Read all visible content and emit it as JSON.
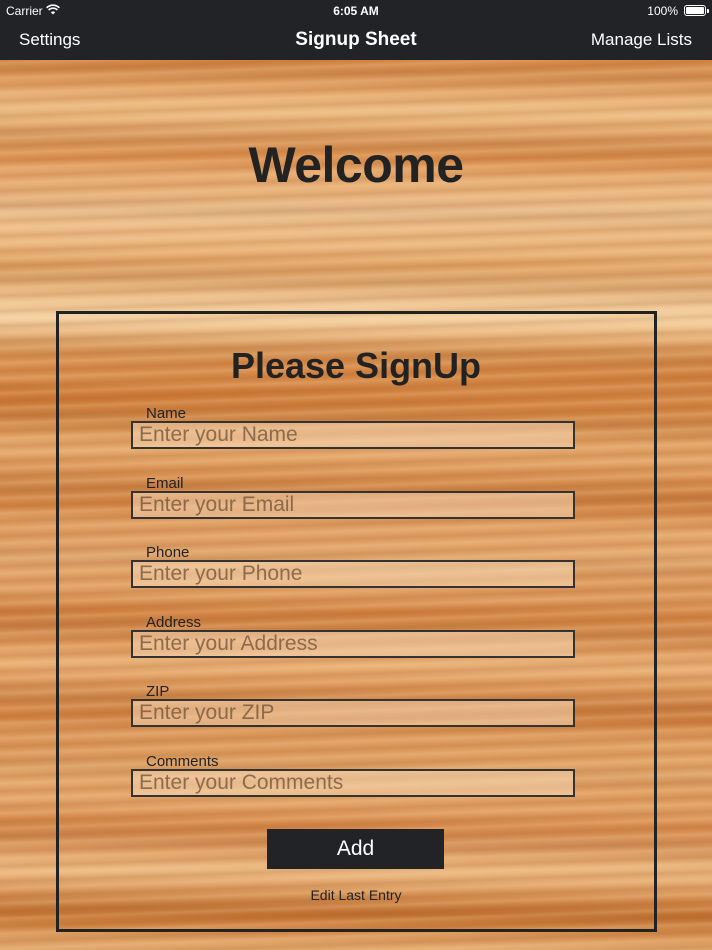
{
  "status_bar": {
    "carrier": "Carrier",
    "time": "6:05 AM",
    "battery": "100%"
  },
  "nav": {
    "left": "Settings",
    "title": "Signup Sheet",
    "right": "Manage Lists"
  },
  "welcome": "Welcome",
  "form": {
    "heading": "Please SignUp",
    "fields": [
      {
        "label": "Name",
        "placeholder": "Enter your Name",
        "value": ""
      },
      {
        "label": "Email",
        "placeholder": "Enter your Email",
        "value": ""
      },
      {
        "label": "Phone",
        "placeholder": "Enter your Phone",
        "value": ""
      },
      {
        "label": "Address",
        "placeholder": "Enter your Address",
        "value": ""
      },
      {
        "label": "ZIP",
        "placeholder": "Enter your ZIP",
        "value": ""
      },
      {
        "label": "Comments",
        "placeholder": "Enter your Comments",
        "value": ""
      }
    ],
    "add_label": "Add",
    "edit_last_label": "Edit Last Entry"
  },
  "icons": [
    "wifi-icon",
    "battery-icon"
  ],
  "colors": {
    "bar": "#222327",
    "text": "#222222",
    "button": "#222327"
  }
}
